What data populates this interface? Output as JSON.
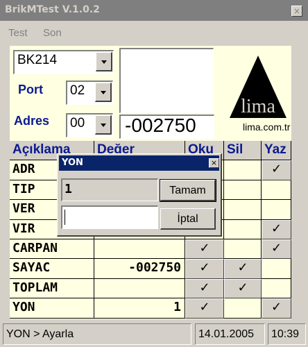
{
  "window": {
    "title": "BrikMTest V.1.0.2",
    "close_glyph": "×"
  },
  "menu": {
    "items": [
      {
        "label": "Test"
      },
      {
        "label": "Son"
      }
    ]
  },
  "device": {
    "device_value": "BK214",
    "port_label": "Port",
    "port_value": "02",
    "address_label": "Adres",
    "address_value": "00",
    "reading": "-002750"
  },
  "logo": {
    "text": "lima",
    "site": "lima.com.tr"
  },
  "table": {
    "headers": {
      "aciklama": "Açıklama",
      "deger": "Değer",
      "oku": "Oku",
      "sil": "Sil",
      "yaz": "Yaz"
    },
    "check_glyph": "✓",
    "rows": [
      {
        "name": "ADR",
        "value": "",
        "oku": false,
        "sil": false,
        "yaz": true
      },
      {
        "name": "TIP",
        "value": "",
        "oku": false,
        "sil": false,
        "yaz": false
      },
      {
        "name": "VER",
        "value": "",
        "oku": false,
        "sil": false,
        "yaz": false
      },
      {
        "name": "VIR",
        "value": "",
        "oku": false,
        "sil": false,
        "yaz": true
      },
      {
        "name": "CARPAN",
        "value": "",
        "oku": true,
        "sil": false,
        "yaz": true
      },
      {
        "name": "SAYAC",
        "value": "-002750",
        "oku": true,
        "sil": true,
        "yaz": false
      },
      {
        "name": "TOPLAM",
        "value": "",
        "oku": true,
        "sil": true,
        "yaz": false
      },
      {
        "name": "YON",
        "value": "1",
        "oku": true,
        "sil": false,
        "yaz": true
      }
    ]
  },
  "dialog": {
    "title": "YON",
    "close_glyph": "×",
    "current_value": "1",
    "input_value": "",
    "ok_label": "Tamam",
    "cancel_label": "İptal"
  },
  "status": {
    "text": "YON > Ayarla",
    "date": "14.01.2005",
    "time": "10:39"
  }
}
